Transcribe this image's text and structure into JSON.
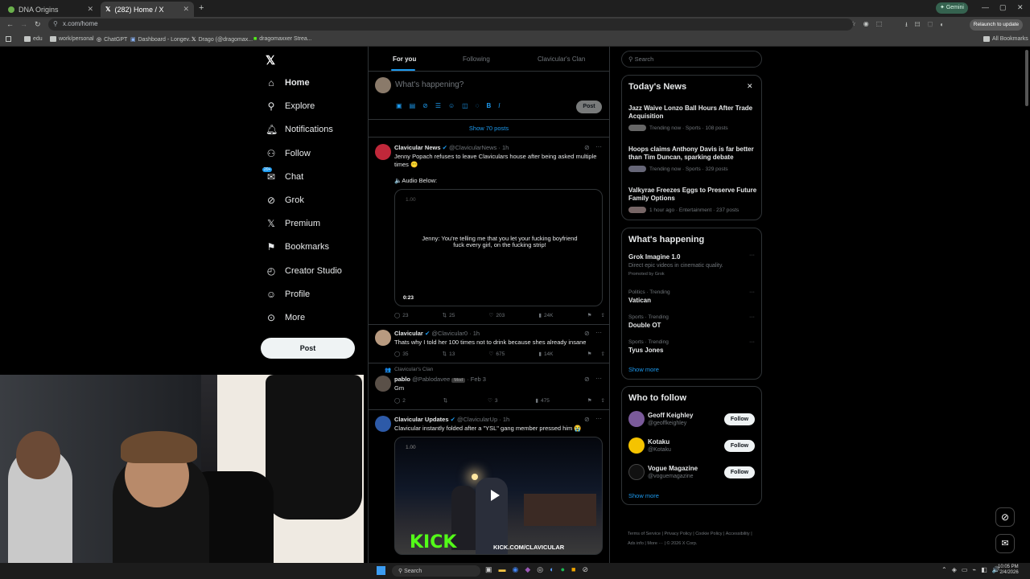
{
  "browser": {
    "tabs": [
      {
        "title": "DNA Origins",
        "active": false
      },
      {
        "title": "(282) Home / X",
        "active": true
      }
    ],
    "url": "x.com/home",
    "gemini_label": "Gemini",
    "relaunch_label": "Relaunch to update",
    "bookmarks": [
      "edu",
      "work/personal",
      "ChatGPT",
      "Dashboard - Longev...",
      "Drago (@dragomax...",
      "dragomaxxer Strea..."
    ],
    "all_bookmarks": "All Bookmarks"
  },
  "nav": {
    "items": [
      {
        "label": "Home",
        "icon": "home-icon"
      },
      {
        "label": "Explore",
        "icon": "search-icon"
      },
      {
        "label": "Notifications",
        "icon": "bell-icon"
      },
      {
        "label": "Follow",
        "icon": "person-plus-icon"
      },
      {
        "label": "Chat",
        "icon": "chat-icon",
        "badge": "20+"
      },
      {
        "label": "Grok",
        "icon": "grok-icon"
      },
      {
        "label": "Premium",
        "icon": "x-logo-icon"
      },
      {
        "label": "Bookmarks",
        "icon": "bookmark-icon"
      },
      {
        "label": "Creator Studio",
        "icon": "creator-icon"
      },
      {
        "label": "Profile",
        "icon": "profile-icon"
      },
      {
        "label": "More",
        "icon": "more-circle-icon"
      }
    ],
    "post_button": "Post"
  },
  "feed": {
    "tabs": [
      "For you",
      "Following",
      "Clavicular's Clan"
    ],
    "compose_placeholder": "What's happening?",
    "compose_post": "Post",
    "show_posts": "Show 70 posts",
    "posts": [
      {
        "name": "Clavicular News",
        "handle": "@ClavicularNews",
        "time": "· 1h",
        "text": "Jenny Popach refuses to leave Claviculars house after being asked multiple times 😶",
        "sub": "🔈Audio Below:",
        "media_caption": "Jenny: You're telling me that you let your fucking boyfriend fuck every girl, on the fucking strip!",
        "media_speed": "1.00",
        "media_time": "0:23",
        "stats": {
          "replies": "23",
          "reposts": "25",
          "likes": "203",
          "views": "24K"
        }
      },
      {
        "name": "Clavicular",
        "handle": "@Clavicular0",
        "time": "· 1h",
        "text": "Thats why I told her 100 times not to drink because shes already insane",
        "stats": {
          "replies": "35",
          "reposts": "13",
          "likes": "675",
          "views": "14K"
        }
      },
      {
        "context": "Clavicular's Clan",
        "name": "pablo",
        "handle": "@Pablodavee",
        "badge": "Mod",
        "time": "· Feb 3",
        "text": "Gm",
        "stats": {
          "replies": "2",
          "reposts": "",
          "likes": "3",
          "views": "475"
        }
      },
      {
        "name": "Clavicular Updates",
        "handle": "@ClavicularUp",
        "time": "· 1h",
        "text": "Clavicular instantly folded after a \"YSL\" gang member pressed him 😭",
        "media_speed": "1.00",
        "media_brand": "KICK",
        "media_url": "KICK.COM/CLAVICULAR"
      }
    ]
  },
  "sidebar": {
    "search_placeholder": "Search",
    "news_title": "Today's News",
    "news": [
      {
        "title": "Jazz Waive Lonzo Ball Hours After Trade Acquisition",
        "meta": "Trending now · Sports · 108 posts"
      },
      {
        "title": "Hoops claims Anthony Davis is far better than Tim Duncan, sparking debate",
        "meta": "Trending now · Sports · 329 posts"
      },
      {
        "title": "Valkyrae Freezes Eggs to Preserve Future Family Options",
        "meta": "1 hour ago · Entertainment · 237 posts"
      }
    ],
    "happening_title": "What's happening",
    "trends": [
      {
        "meta": "",
        "title": "Grok Imagine 1.0",
        "desc": "Direct epic videos in cinematic quality.",
        "promo": "Promoted by Grok"
      },
      {
        "meta": "Politics · Trending",
        "title": "Vatican"
      },
      {
        "meta": "Sports · Trending",
        "title": "Double OT"
      },
      {
        "meta": "Sports · Trending",
        "title": "Tyus Jones"
      }
    ],
    "show_more": "Show more",
    "wtf_title": "Who to follow",
    "follow": [
      {
        "name": "Geoff Keighley",
        "handle": "@geoffkeighley"
      },
      {
        "name": "Kotaku",
        "handle": "@Kotaku"
      },
      {
        "name": "Vogue Magazine",
        "handle": "@voguemagazine"
      }
    ],
    "follow_label": "Follow",
    "footer": [
      "Terms of Service",
      "Privacy Policy",
      "Cookie Policy",
      "Accessibility",
      "Ads info",
      "More ···",
      "© 2026 X Corp."
    ]
  },
  "taskbar": {
    "search": "Search",
    "time": "10:05 PM",
    "date": "2/4/2026"
  },
  "colors": {
    "accent": "#1d9bf0",
    "bg": "#000000",
    "border": "#2f3336",
    "kick": "#53fc18"
  }
}
